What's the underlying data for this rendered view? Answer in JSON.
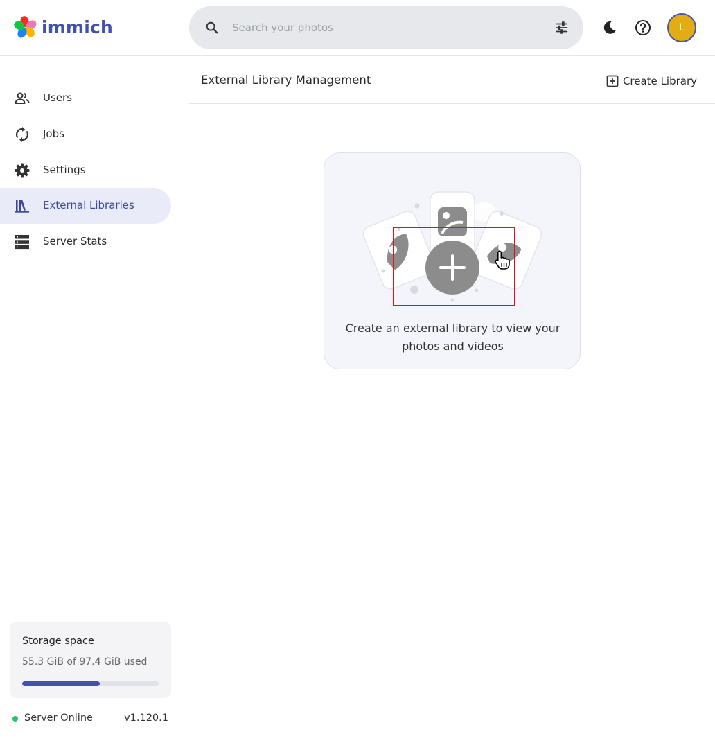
{
  "app": {
    "name": "immich"
  },
  "search": {
    "placeholder": "Search your photos"
  },
  "user": {
    "initial": "L",
    "avatar_color": "#e3ac12"
  },
  "sidebar": {
    "items": [
      {
        "label": "Users",
        "icon": "users-icon",
        "active": false
      },
      {
        "label": "Jobs",
        "icon": "sync-icon",
        "active": false
      },
      {
        "label": "Settings",
        "icon": "gear-icon",
        "active": false
      },
      {
        "label": "External Libraries",
        "icon": "library-icon",
        "active": true
      },
      {
        "label": "Server Stats",
        "icon": "server-icon",
        "active": false
      }
    ],
    "storage": {
      "title": "Storage space",
      "used_text": "55.3 GiB of 97.4 GiB used",
      "used_fraction": 0.568
    },
    "status": {
      "text": "Server Online",
      "version": "v1.120.1",
      "color": "#22c55e"
    }
  },
  "main": {
    "title": "External Library Management",
    "create_label": "Create Library",
    "empty_message": "Create an external library to view your photos and videos"
  },
  "colors": {
    "accent": "#4250af",
    "active_bg": "#e9ebf8",
    "highlight": "#e3101a"
  }
}
